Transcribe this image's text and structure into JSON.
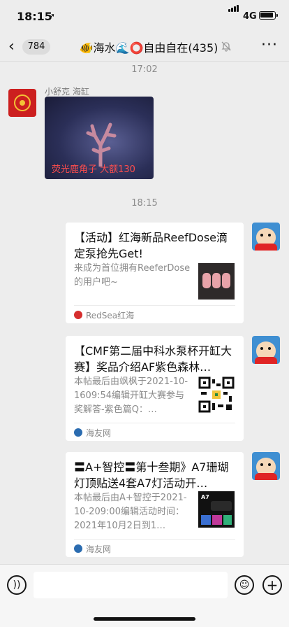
{
  "status_bar": {
    "time": "18:15",
    "network": "4G"
  },
  "nav": {
    "back_icon": "chevron-left-icon",
    "unread_count": "784",
    "title": "🐠海水🌊⭕自由自在(435)",
    "mute_icon": "muted-bell-icon",
    "more_icon": "more-dots-icon"
  },
  "messages": [
    {
      "time": "17:02",
      "sender_name": "小舒克 海缸",
      "image_overlay": "荧光鹿角子 大额130"
    },
    {
      "time": "18:15",
      "cards": [
        {
          "title": "【活动】红海新品ReefDose滴定泵抢先Get!",
          "desc": "来成为首位拥有ReeferDose的用户吧~",
          "source": "RedSea红海",
          "source_color": "#d62e2e"
        },
        {
          "title": "【CMF第二届中科水泵杯开缸大赛】奖品介绍AF紫色森林…",
          "desc": "本帖最后由飒枫于2021-10-1609:54编辑开缸大赛参与奖解答-紫色篇Q：…",
          "source": "海友网",
          "source_color": "#2b6cb0"
        },
        {
          "title": "〓A+智控〓第十叁期》A7珊瑚灯顶贴送4套A7灯活动开…",
          "desc": "本帖最后由A+智控于2021-10-209:00编辑活动时间：2021年10月2日到1…",
          "source": "海友网",
          "source_color": "#2b6cb0"
        }
      ]
    }
  ],
  "input_bar": {
    "voice_icon": "voice-input-icon",
    "emoji_icon": "emoji-icon",
    "plus_icon": "plus-icon"
  }
}
